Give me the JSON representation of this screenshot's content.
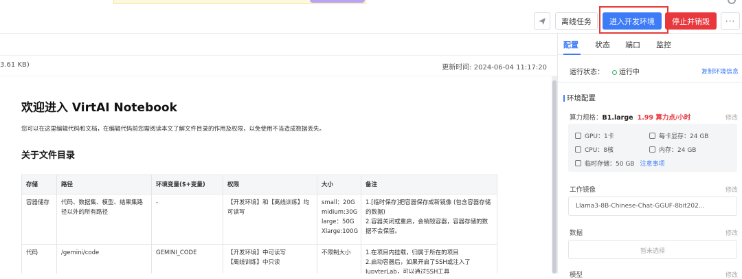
{
  "toolbar": {
    "offline_task": "离线任务",
    "enter_dev": "进入开发环境",
    "stop_destroy": "停止并销毁",
    "more": "···"
  },
  "filebar": {
    "size": "3.61 KB)",
    "updated": "更新时间:  2024-06-04 11:17:20"
  },
  "doc": {
    "title": "欢迎进入 VirtAI Notebook",
    "intro": "您可以在这里编辑代码和文档，在编辑代码前您需阅读本文了解文件目录的作用及权限，以免使用不当造成数据丢失。",
    "section": "关于文件目录",
    "columns": [
      "存储",
      "路径",
      "环境变量($+变量)",
      "权限",
      "大小",
      "备注"
    ],
    "rows": [
      {
        "storage": "容器储存",
        "path": "代码、数据集、模型、结果集路径以外的所有路径",
        "env": "-",
        "perm": "【开发环境】和【离线训练】均可读写",
        "size": "small：20G\nmidium:30G\nlarge：50G\nXlarge:100G",
        "note": "1.[临时保存]把容器保存成新镜像 (包含容器存储的数据)\n2.容器关闭或重启，会销毁容器，容器存储的数据不会保留。"
      },
      {
        "storage": "代码",
        "path": "/gemini/code",
        "env": "GEMINI_CODE",
        "perm": "【开发环境】中可读写\n【离线训练】中只读",
        "size": "不限制大小",
        "note": "1.在项目内挂载，归属于所在的项目\n2.启动容器后，如果开启了SSH或注入了JupyterLab，可以通过SSH工具"
      }
    ]
  },
  "panel": {
    "tabs": [
      "配置",
      "状态",
      "端口",
      "监控"
    ],
    "status_label": "运行状态：",
    "status_value": "运行中",
    "copy_info": "复制环境信息",
    "section_title": "环境配置",
    "spec_label": "算力规格：",
    "spec_value": "B1.large",
    "spec_price": "1.99 算力点/小时",
    "edit": "修改",
    "resources": {
      "gpu": "GPU：1卡",
      "vram": "每卡显存：24 GB",
      "cpu": "CPU：8核",
      "mem": "内存：24 GB",
      "disk": "临时存储：50 GB",
      "notice": "注意事项"
    },
    "image_label": "工作镜像",
    "image_value": "Llama3-8B-Chinese-Chat-GGUF-8bit202...",
    "data_label": "数据",
    "data_placeholder": "暂未选择",
    "model_label": "模型"
  },
  "colors": {
    "primary": "#3e7cf7",
    "danger": "#e8383d",
    "running": "#2fb36a",
    "highlight": "#e53935"
  }
}
